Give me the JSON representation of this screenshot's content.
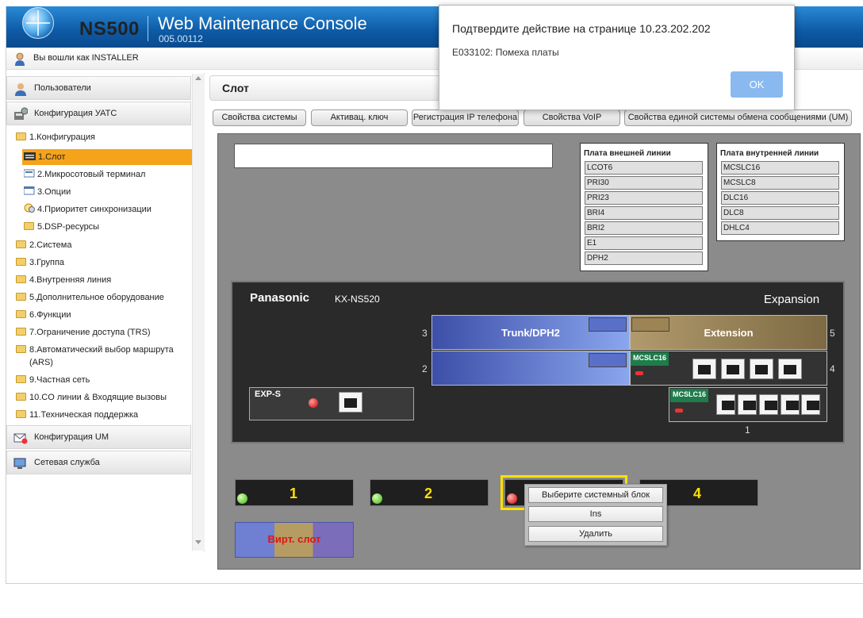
{
  "header": {
    "product": "NS500",
    "title": "Web Maintenance Console",
    "version": "005.00112"
  },
  "userbar": {
    "text": "Вы вошли как INSTALLER"
  },
  "sidebar": {
    "users": "Пользователи",
    "pbx_config": "Конфигурация УАТС",
    "config_folder": "1.Конфигурация",
    "config_items": [
      "1.Слот",
      "2.Микросотовый терминал",
      "3.Опции",
      "4.Приоритет синхронизации",
      "5.DSP-ресурсы"
    ],
    "folders": [
      "2.Система",
      "3.Группа",
      "4.Внутренняя линия",
      "5.Дополнительное оборудование",
      "6.Функции",
      "7.Ограничение доступа (TRS)",
      "8.Автоматический выбор маршрута",
      "(ARS)",
      "9.Частная сеть",
      "10.CO линии & Входящие вызовы",
      "11.Техническая поддержка"
    ],
    "um_config": "Конфигурация UM",
    "net_service": "Сетевая служба"
  },
  "main": {
    "page_title": "Слот",
    "tabs": [
      "Свойства системы",
      "Активац. ключ",
      "Регистрация IP телефона",
      "Свойства VoIP",
      "Свойства единой системы обмена сообщениями (UM)"
    ]
  },
  "cards": {
    "trunk_title": "Плата внешней линии",
    "trunk": [
      "LCOT6",
      "PRI30",
      "PRI23",
      "BRI4",
      "BRI2",
      "E1",
      "DPH2"
    ],
    "ext_title": "Плата внутренней линии",
    "ext": [
      "MCSLC16",
      "MCSLC8",
      "DLC16",
      "DLC8",
      "DHLC4"
    ]
  },
  "chassis": {
    "brand": "Panasonic",
    "model": "KX-NS520",
    "expansion": "Expansion",
    "slot_trunk_label": "Trunk/DPH2",
    "slot_ext_label": "Extension",
    "slot_numbers": [
      "3",
      "2",
      "5",
      "4",
      "1"
    ],
    "card4": "MCSLC16",
    "card1": "MCSLC16",
    "exp_s": "EXP-S"
  },
  "units": {
    "numbers": [
      "1",
      "2",
      "4"
    ],
    "virtual": "Вирт. слот"
  },
  "context_menu": [
    "Выберите системный блок",
    "Ins",
    "Удалить"
  ],
  "dialog": {
    "title": "Подтвердите действие на странице 10.23.202.202",
    "message": "E033102: Помеха платы",
    "ok": "OK"
  },
  "colors": {
    "header_blue": "#0d5aa6",
    "selection_orange": "#f5a31a",
    "highlight_yellow": "#ffe000",
    "ok_button": "#8ab9f0"
  }
}
